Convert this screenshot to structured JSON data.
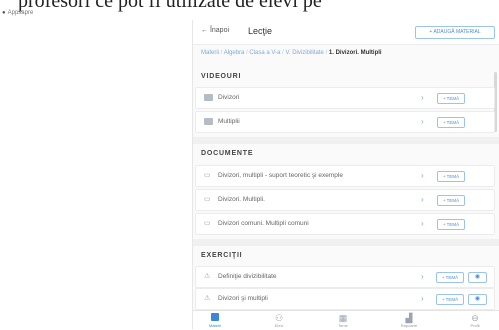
{
  "banner": {
    "text": "profesori ce pot fi utilizate de elevi pe"
  },
  "app_label": "Appsapre",
  "topbar": {
    "back_label": "Înapoi",
    "title": "Lecţie",
    "add_button_label": "+ ADAUGĂ MATERIAL"
  },
  "breadcrumb": {
    "items": [
      "Materii",
      "Algebra",
      "Clasa a V-a",
      "V. Divizibilitate"
    ],
    "current": "1. Divizori. Multipli"
  },
  "sections": {
    "videos": {
      "title": "VIDEOURI",
      "items": [
        {
          "label": "Divizori",
          "button": "+ TEMĂ"
        },
        {
          "label": "Multiplii",
          "button": "+ TEMĂ"
        }
      ]
    },
    "documents": {
      "title": "DOCUMENTE",
      "items": [
        {
          "label": "Divizori, multipli - suport teoretic şi exemple",
          "button": "+ TEMĂ"
        },
        {
          "label": "Divizori. Multipli.",
          "button": "+ TEMĂ"
        },
        {
          "label": "Divizori comuni. Multipli comuni",
          "button": "+ TEMĂ"
        }
      ]
    },
    "exercises": {
      "title": "EXERCIŢII",
      "items": [
        {
          "label": "Definiţie divizibilitate",
          "button": "+ TEMĂ",
          "eye": "◉"
        },
        {
          "label": "Divizori şi multipli",
          "button": "+ TEMĂ",
          "eye": "◉"
        }
      ]
    }
  },
  "bottom_nav": {
    "items": [
      {
        "label": "Materii",
        "icon": "book-icon"
      },
      {
        "label": "Elevi",
        "icon": "people-icon"
      },
      {
        "label": "Teme",
        "icon": "calendar-icon"
      },
      {
        "label": "Rapoarte",
        "icon": "chart-icon"
      },
      {
        "label": "Profil",
        "icon": "user-icon"
      }
    ]
  },
  "colors": {
    "accent": "#3a86d9",
    "link": "#7fa9d8",
    "border": "#9cc4ea"
  }
}
